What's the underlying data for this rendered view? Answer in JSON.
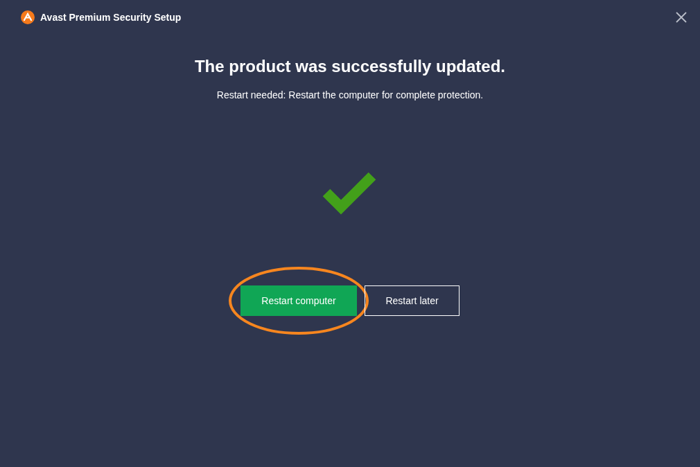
{
  "window": {
    "title": "Avast Premium Security Setup"
  },
  "heading": "The product was successfully updated.",
  "message": "Restart needed: Restart the computer for complete protection.",
  "status": {
    "kind": "success"
  },
  "buttons": [
    {
      "label": "Restart computer",
      "kind": "primary",
      "highlighted": true
    },
    {
      "label": "Restart later",
      "kind": "secondary",
      "highlighted": false
    }
  ]
}
